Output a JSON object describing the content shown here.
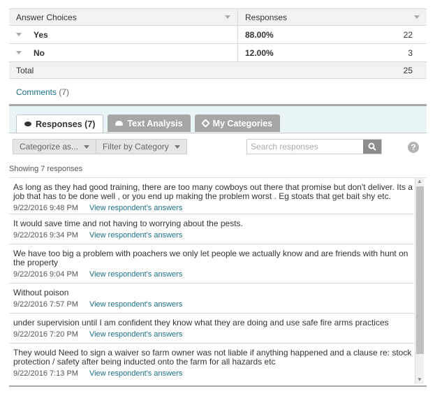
{
  "table": {
    "col_answer": "Answer Choices",
    "col_responses": "Responses",
    "rows": [
      {
        "label": "Yes",
        "percent": "88.00%",
        "count": "22"
      },
      {
        "label": "No",
        "percent": "12.00%",
        "count": "3"
      }
    ],
    "total_label": "Total",
    "total_value": "25"
  },
  "comments": {
    "label": "Comments",
    "count": "(7)"
  },
  "tabs": [
    {
      "label": "Responses (7)",
      "icon": "speech-bubble-icon"
    },
    {
      "label": "Text Analysis",
      "icon": "cloud-icon"
    },
    {
      "label": "My Categories",
      "icon": "tag-icon"
    }
  ],
  "toolbar": {
    "categorize": "Categorize as...",
    "filter": "Filter by Category",
    "search_placeholder": "Search responses",
    "help": "?"
  },
  "showing": "Showing 7 responses",
  "view_link": "View respondent's answers",
  "responses": [
    {
      "text": "As long as they had good training, there are too many cowboys out there that promise but don't deliver. Its a job that has to be done well , or you end up making the problem worst . Eg stoats that get bait shy etc.",
      "date": "9/22/2016 9:48 PM"
    },
    {
      "text": "It would save time and not having to worrying about the pests.",
      "date": "9/22/2016 9:34 PM"
    },
    {
      "text": "We have too big a problem with poachers we only let people we actually know and are friends with hunt on the property",
      "date": "9/22/2016 9:04 PM"
    },
    {
      "text": "Without poison",
      "date": "9/22/2016 7:57 PM"
    },
    {
      "text": "under supervision until I am confident they know what they are doing and use safe fire arms practices",
      "date": "9/22/2016 7:20 PM"
    },
    {
      "text": "They would Need to sign a waiver so farm owner was not liable if anything happened and a clause re: stock protection / safety after being inducted onto the farm for all hazards etc",
      "date": "9/22/2016 7:13 PM"
    }
  ]
}
